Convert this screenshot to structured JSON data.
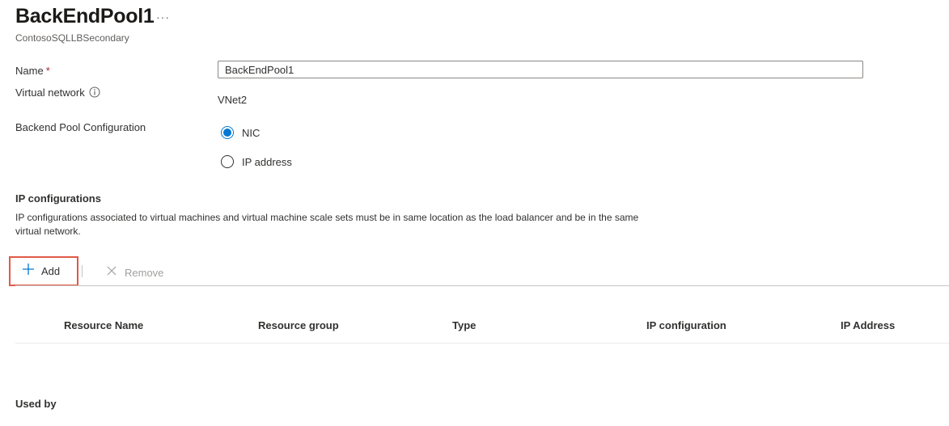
{
  "header": {
    "title": "BackEndPool1",
    "more_label": "···",
    "subtitle": "ContosoSQLLBSecondary"
  },
  "form": {
    "name_label": "Name",
    "required_marker": "*",
    "name_value": "BackEndPool1",
    "vnet_label": "Virtual network",
    "vnet_value": "VNet2",
    "pool_config_label": "Backend Pool Configuration",
    "options": [
      {
        "label": "NIC",
        "selected": true
      },
      {
        "label": "IP address",
        "selected": false
      }
    ]
  },
  "ip_configurations": {
    "title": "IP configurations",
    "description": "IP configurations associated to virtual machines and virtual machine scale sets must be in same location as the load balancer and be in the same virtual network.",
    "add_label": "Add",
    "remove_label": "Remove",
    "columns": [
      "Resource Name",
      "Resource group",
      "Type",
      "IP configuration",
      "IP Address"
    ]
  },
  "used_by": {
    "title": "Used by"
  },
  "colors": {
    "accent": "#0078d4",
    "highlight_border": "#e05a47",
    "required": "#a4262c"
  },
  "icons": {
    "more": "more-icon",
    "info": "info-icon",
    "add": "plus-icon",
    "remove": "close-icon"
  }
}
